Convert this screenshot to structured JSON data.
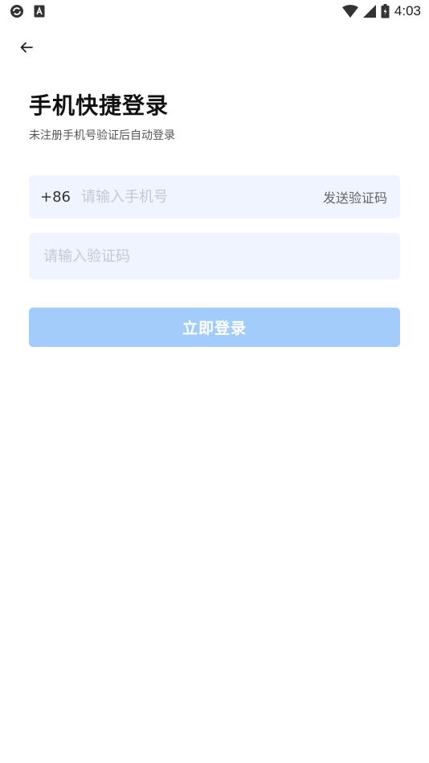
{
  "status_bar": {
    "time": "4:03",
    "left_icons": [
      "settings-sync-icon",
      "text-notification-icon"
    ],
    "right_icons": [
      "wifi-icon",
      "signal-icon",
      "battery-icon"
    ]
  },
  "header": {
    "back_icon": "arrow-left-icon"
  },
  "main": {
    "title": "手机快捷登录",
    "subtitle": "未注册手机号验证后自动登录",
    "phone": {
      "country_code": "+86",
      "placeholder": "请输入手机号",
      "value": "",
      "send_code_label": "发送验证码"
    },
    "code": {
      "placeholder": "请输入验证码",
      "value": ""
    },
    "login_label": "立即登录"
  },
  "colors": {
    "field_background": "#f0f4ff",
    "button_disabled": "#a3ccfa",
    "title_text": "#111111"
  }
}
